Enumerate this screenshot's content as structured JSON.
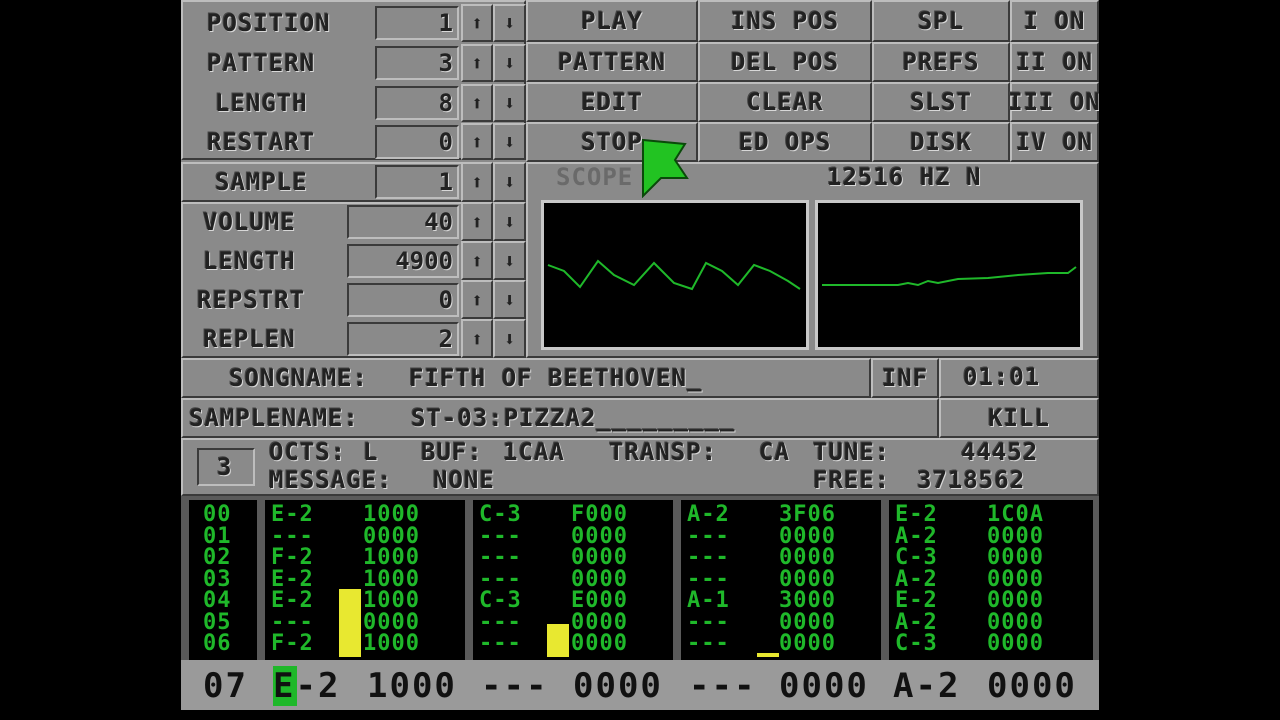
{
  "left_panel": {
    "position": {
      "label": "POSITION",
      "value": "1"
    },
    "pattern": {
      "label": "PATTERN",
      "value": "3"
    },
    "length": {
      "label": "LENGTH",
      "value": "8"
    },
    "restart": {
      "label": "RESTART",
      "value": "0"
    },
    "sample": {
      "label": "SAMPLE",
      "value": "1"
    },
    "volume": {
      "label": "VOLUME",
      "value": "40"
    },
    "smp_length": {
      "label": "LENGTH",
      "value": "4900"
    },
    "repstrt": {
      "label": "REPSTRT",
      "value": "0"
    },
    "replen": {
      "label": "REPLEN",
      "value": "2"
    }
  },
  "buttons": {
    "play": "PLAY",
    "pattern": "PATTERN",
    "edit": "EDIT",
    "stop": "STOP",
    "ins_pos": "INS POS",
    "del_pos": "DEL POS",
    "clear": "CLEAR",
    "ed_ops": "ED OPS",
    "spl": "SPL",
    "prefs": "PREFS",
    "slst": "SLST",
    "disk": "DISK",
    "inf": "INF",
    "kill": "KILL"
  },
  "channels": [
    {
      "label": "I ON"
    },
    {
      "label": "II ON"
    },
    {
      "label": "III ON"
    },
    {
      "label": "IV ON"
    }
  ],
  "scope": {
    "label": "SCOPE",
    "rate": "12516 HZ N"
  },
  "song": {
    "label": "SONGNAME:",
    "name": "FIFTH OF BEETHOVEN_",
    "time": "01:01"
  },
  "sample_name": {
    "label": "SAMPLENAME:",
    "name": "ST-03:PIZZA2_________"
  },
  "info": {
    "octave_box": "3",
    "octs_label": "OCTS:",
    "octs_value": "L",
    "buf_label": "BUF:",
    "buf_value": "1CAA",
    "transp_label": "TRANSP:",
    "transp_value": "CA",
    "tune_label": "TUNE:",
    "tune_value": "44452",
    "message_label": "MESSAGE:",
    "message_value": "NONE",
    "free_label": "FREE:",
    "free_value": "3718562"
  },
  "pattern_editor": {
    "rows": [
      "00",
      "01",
      "02",
      "03",
      "04",
      "05",
      "06"
    ],
    "tracks": [
      {
        "notes": [
          "E-2",
          "---",
          "F-2",
          "E-2",
          "E-2",
          "---",
          "F-2"
        ],
        "fx": [
          "1000",
          "0000",
          "1000",
          "1000",
          "1000",
          "0000",
          "1000"
        ],
        "vu": 0.62
      },
      {
        "notes": [
          "C-3",
          "---",
          "---",
          "---",
          "C-3",
          "---",
          "---"
        ],
        "fx": [
          "F000",
          "0000",
          "0000",
          "0000",
          "E000",
          "0000",
          "0000"
        ],
        "vu": 0.3
      },
      {
        "notes": [
          "A-2",
          "---",
          "---",
          "---",
          "A-1",
          "---",
          "---"
        ],
        "fx": [
          "3F06",
          "0000",
          "0000",
          "0000",
          "3000",
          "0000",
          "0000"
        ],
        "vu": 0.04
      },
      {
        "notes": [
          "E-2",
          "A-2",
          "C-3",
          "A-2",
          "E-2",
          "A-2",
          "C-3"
        ],
        "fx": [
          "1C0A",
          "0000",
          "0000",
          "0000",
          "0000",
          "0000",
          "0000"
        ],
        "vu": 0
      }
    ],
    "current_row": {
      "row": "07",
      "tracks": [
        {
          "note": "E-2",
          "fx": "1000"
        },
        {
          "note": "---",
          "fx": "0000"
        },
        {
          "note": "---",
          "fx": "0000"
        },
        {
          "note": "A-2",
          "fx": "0000"
        }
      ]
    }
  },
  "colors": {
    "panel": "#8a8a8a",
    "pattern_text": "#1fb82a",
    "scope_wave": "#1fb82a",
    "vu_meter": "#e8e830",
    "pointer": "#22c322"
  },
  "icons": {
    "up": "arrow-up-icon",
    "down": "arrow-down-icon",
    "pointer": "mouse-pointer-icon"
  }
}
